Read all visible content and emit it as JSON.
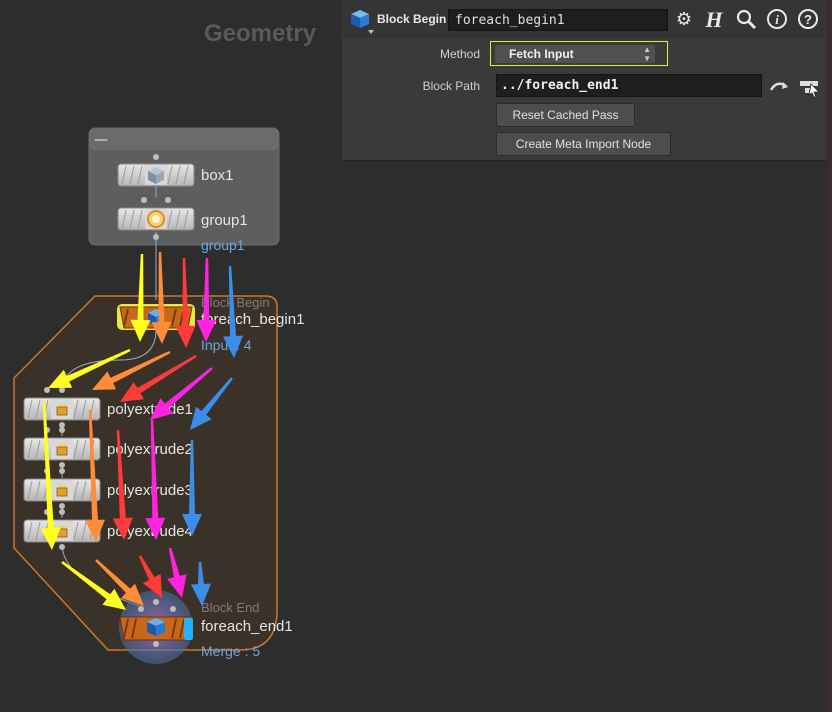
{
  "context_title": "Geometry",
  "panel": {
    "node_type": "Block Begin",
    "node_name": "foreach_begin1",
    "header_icons": [
      "gear-icon",
      "houdini-h-icon",
      "search-icon",
      "info-icon",
      "help-icon"
    ],
    "method_label": "Method",
    "method_value": "Fetch Input",
    "block_path_label": "Block Path",
    "block_path_value": "../foreach_end1",
    "reset_button": "Reset Cached Pass",
    "create_meta_button": "Create Meta Import Node"
  },
  "network_box": {
    "collapse_symbol": "—"
  },
  "nodes": {
    "box1": {
      "name": "box1"
    },
    "group1": {
      "name": "group1",
      "sub": "group1"
    },
    "foreach_begin1": {
      "type": "Block Begin",
      "name": "foreach_begin1",
      "sub": "Input : 4"
    },
    "polyextrude1": {
      "name": "polyextrude1"
    },
    "polyextrude2": {
      "name": "polyextrude2"
    },
    "polyextrude3": {
      "name": "polyextrude3"
    },
    "polyextrude4": {
      "name": "polyextrude4"
    },
    "foreach_end1": {
      "type": "Block End",
      "name": "foreach_end1",
      "sub": "Merge : 5"
    }
  },
  "colors": {
    "yellow": "#ffff22",
    "orange": "#ff8c3a",
    "red": "#ff3a3a",
    "magenta": "#ff22e0",
    "blue": "#3a8ee8",
    "block_outline": "#c97a2a",
    "block_node": "#c8661a",
    "highlight": "#e8e840"
  }
}
